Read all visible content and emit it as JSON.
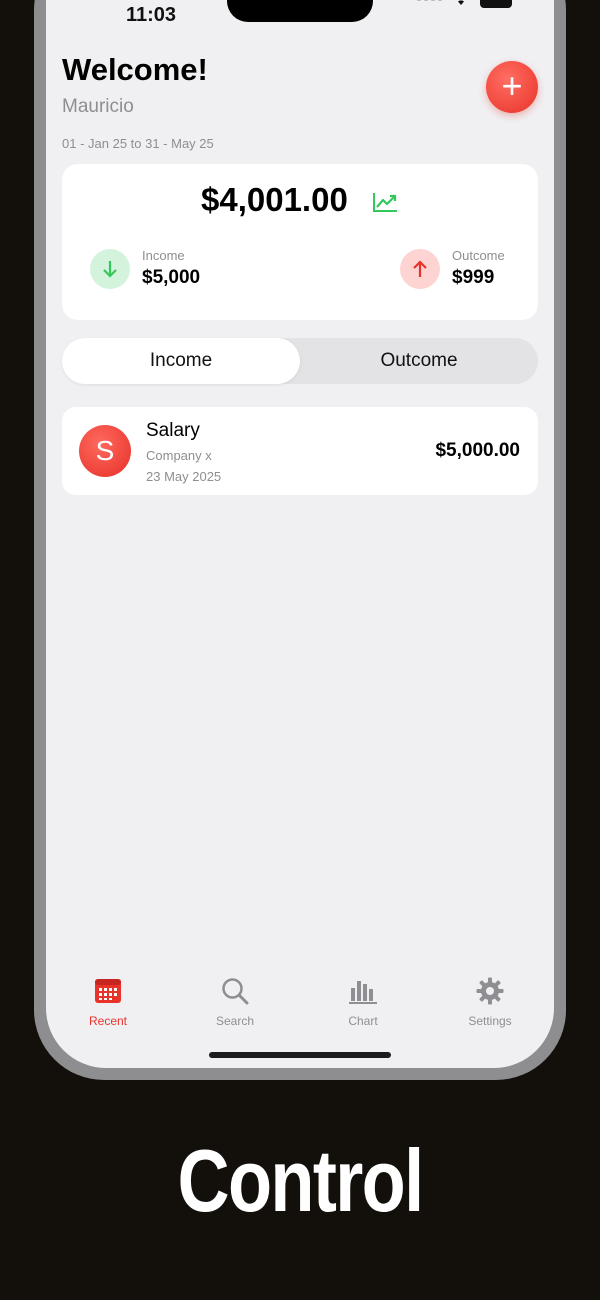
{
  "status_bar": {
    "time": "11:03"
  },
  "header": {
    "welcome": "Welcome!",
    "username": "Mauricio",
    "date_range": "01 - Jan 25 to 31 - May 25",
    "add_icon": "plus-icon"
  },
  "balance": {
    "amount": "$4,001.00",
    "trend_icon": "trend-up-icon",
    "income_label": "Income",
    "income_value": "$5,000",
    "outcome_label": "Outcome",
    "outcome_value": "$999"
  },
  "segmented": {
    "income": "Income",
    "outcome": "Outcome",
    "selected": "Income"
  },
  "transactions": [
    {
      "initial": "S",
      "title": "Salary",
      "subtitle": "Company x",
      "date": "23 May 2025",
      "amount": "$5,000.00"
    }
  ],
  "tabbar": {
    "items": [
      {
        "label": "Recent",
        "icon": "calendar-icon",
        "active": true
      },
      {
        "label": "Search",
        "icon": "search-icon",
        "active": false
      },
      {
        "label": "Chart",
        "icon": "bar-chart-icon",
        "active": false
      },
      {
        "label": "Settings",
        "icon": "gear-icon",
        "active": false
      }
    ]
  },
  "caption": "Control",
  "colors": {
    "accent": "#e9322a",
    "income_green": "#34c759",
    "background": "#f0f0f3"
  }
}
